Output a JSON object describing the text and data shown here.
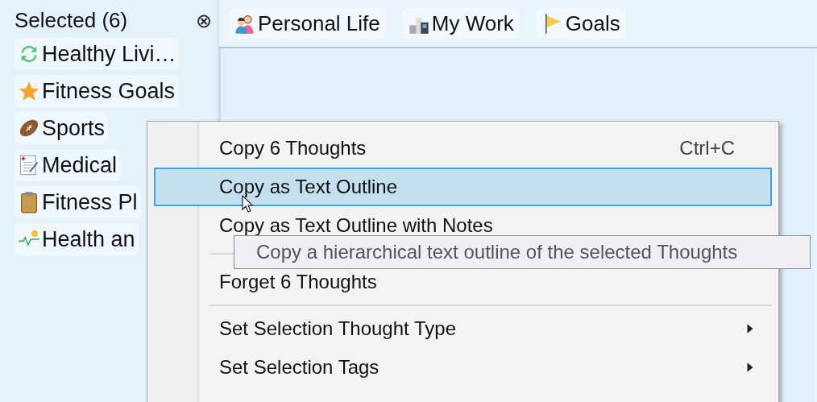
{
  "sidebar": {
    "title": "Selected (6)",
    "close_icon": "⊗",
    "items": [
      {
        "label": "Healthy Livi…"
      },
      {
        "label": "Fitness Goals"
      },
      {
        "label": "Sports"
      },
      {
        "label": "Medical"
      },
      {
        "label": "Fitness Pl"
      },
      {
        "label": "Health an"
      }
    ]
  },
  "tabs": [
    {
      "label": "Personal Life"
    },
    {
      "label": "My Work"
    },
    {
      "label": "Goals"
    }
  ],
  "context_menu": {
    "items": [
      {
        "kind": "item",
        "label": "Copy 6 Thoughts",
        "shortcut": "Ctrl+C",
        "submenu": false,
        "selected": false
      },
      {
        "kind": "item",
        "label": "Copy as Text Outline",
        "submenu": false,
        "selected": true
      },
      {
        "kind": "item",
        "label": "Copy as Text Outline with Notes",
        "submenu": false,
        "selected": false
      },
      {
        "kind": "separator"
      },
      {
        "kind": "item",
        "label": "Forget 6 Thoughts",
        "submenu": false,
        "selected": false
      },
      {
        "kind": "separator"
      },
      {
        "kind": "item",
        "label": "Set Selection Thought Type",
        "submenu": true,
        "selected": false
      },
      {
        "kind": "item",
        "label": "Set Selection Tags",
        "submenu": true,
        "selected": false
      }
    ]
  },
  "tooltip": "Copy a hierarchical text outline of the selected Thoughts"
}
